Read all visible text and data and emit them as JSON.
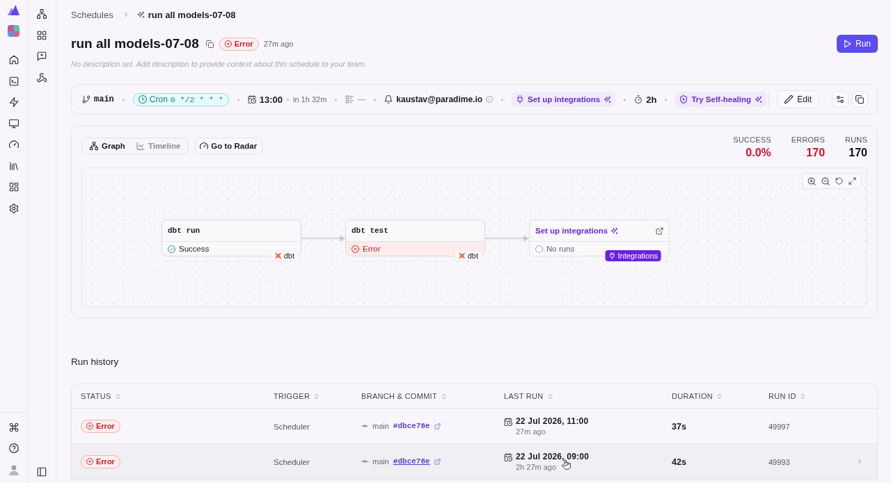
{
  "breadcrumb": {
    "parent": "Schedules",
    "current": "run all models-07-08"
  },
  "header": {
    "title": "run all models-07-08",
    "status": {
      "kind": "error",
      "label": "Error"
    },
    "last_run": "27m ago",
    "description_hint": "No description set. Add description to provide context about this schedule to your team.",
    "run_button": "Run"
  },
  "schedule_bar": {
    "items": [
      {
        "kind": "branch",
        "value": "main"
      },
      {
        "kind": "cron",
        "label": "Cron",
        "value": "0 */2 * * *"
      },
      {
        "kind": "next_run",
        "value": "13:00",
        "note": "in 1h 32m"
      },
      {
        "kind": "notifier",
        "value": "—"
      },
      {
        "kind": "email",
        "value": "kaustav@paradime.io"
      },
      {
        "kind": "integrations",
        "label": "Set up integrations"
      },
      {
        "kind": "timeout",
        "value": "2h"
      },
      {
        "kind": "self_healing",
        "label": "Try Self-healing"
      }
    ],
    "edit_button": "Edit"
  },
  "run_panel": {
    "view_tabs": [
      {
        "label": "Graph",
        "selected": true
      },
      {
        "label": "Timeline",
        "selected": false
      }
    ],
    "radar_button": "Go to Radar",
    "stats": [
      {
        "label": "SUCCESS",
        "value": "0.0%",
        "kind": "error"
      },
      {
        "label": "ERRORS",
        "value": "170",
        "kind": "error"
      },
      {
        "label": "RUNS",
        "value": "170",
        "kind": "neutral"
      }
    ],
    "graph": {
      "nodes": [
        {
          "kind": "command",
          "title": "dbt run",
          "status": {
            "kind": "success",
            "label": "Success"
          },
          "tag": "dbt"
        },
        {
          "kind": "command",
          "title": "dbt test",
          "status": {
            "kind": "error",
            "label": "Error"
          },
          "tag": "dbt"
        },
        {
          "kind": "integration",
          "title": "Set up integrations",
          "status": {
            "kind": "none",
            "label": "No runs"
          },
          "tag": "Integrations"
        }
      ]
    }
  },
  "run_history": {
    "title": "Run history",
    "columns": [
      "STATUS",
      "TRIGGER",
      "BRANCH & COMMIT",
      "LAST RUN",
      "DURATION",
      "RUN ID"
    ],
    "rows": [
      {
        "status": {
          "kind": "error",
          "label": "Error"
        },
        "trigger": "Scheduler",
        "branch": "main",
        "commit": "#dbce78e",
        "date": "22 Jul 2026, 11:00",
        "ago": "27m ago",
        "duration": "37s",
        "run_id": "49997",
        "hovered": false
      },
      {
        "status": {
          "kind": "error",
          "label": "Error"
        },
        "trigger": "Scheduler",
        "branch": "main",
        "commit": "#dbce78e",
        "date": "22 Jul 2026, 09:00",
        "ago": "2h 27m ago",
        "duration": "42s",
        "run_id": "49993",
        "hovered": true
      }
    ]
  }
}
